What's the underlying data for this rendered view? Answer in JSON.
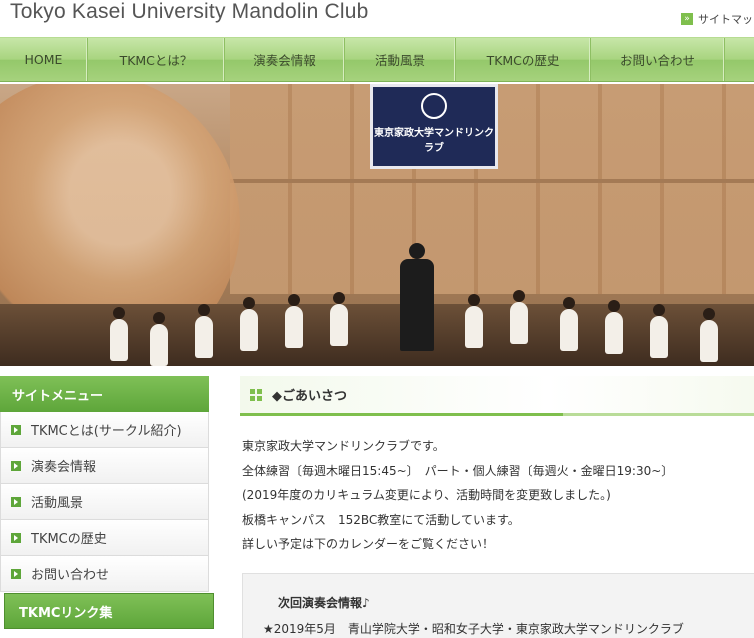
{
  "header": {
    "site_title": "Tokyo Kasei University Mandolin Club",
    "sitemap_label": "サイトマッ"
  },
  "nav": {
    "items": [
      "HOME",
      "TKMCとは？",
      "演奏会情報",
      "活動風景",
      "TKMCの歴史",
      "お問い合わせ"
    ]
  },
  "hero": {
    "banner_text": "東京家政大学マンドリンクラブ"
  },
  "sidebar": {
    "menu_title": "サイトメニュー",
    "items": [
      "TKMCとは(サークル紹介)",
      "演奏会情報",
      "活動風景",
      "TKMCの歴史",
      "お問い合わせ"
    ],
    "links_title": "TKMCリンク集"
  },
  "main": {
    "section_title": "◆ごあいさつ",
    "intro_lines": [
      "東京家政大学マンドリンクラブです。",
      "全体練習〔毎週木曜日15:45~〕　パート・個人練習〔毎週火・金曜日19:30~〕",
      "(2019年度のカリキュラム変更により、活動時間を変更致しました。)",
      "板橋キャンパス　152BC教室にて活動しています。",
      "詳しい予定は下のカレンダーをご覧ください！"
    ],
    "event": {
      "title": "次回演奏会情報♪",
      "line": "★2019年5月　青山学院大学・昭和女子大学・東京家政大学マンドリンクラブ"
    }
  },
  "colors": {
    "accent_green": "#5ea63a",
    "nav_green": "#a8d47f"
  }
}
